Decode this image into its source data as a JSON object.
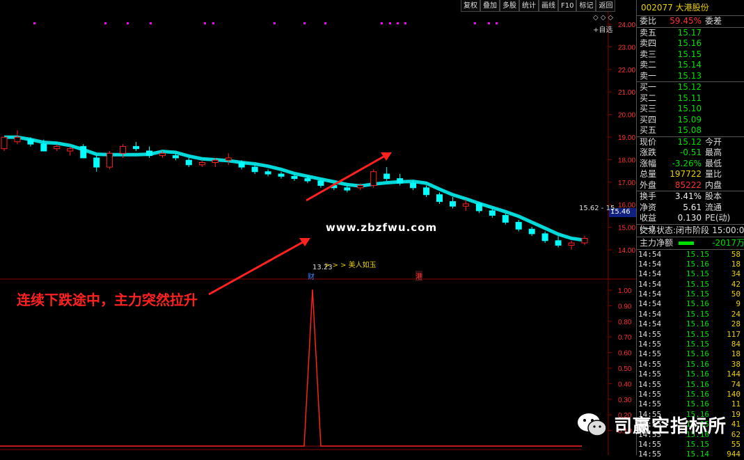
{
  "toolbar": {
    "buttons": [
      "复权",
      "叠加",
      "多股",
      "统计",
      "画线",
      "F10",
      "标记",
      "返回"
    ],
    "auto_select": "+自选",
    "window_controls": [
      "◇",
      "◇",
      "◇"
    ]
  },
  "stock": {
    "code": "002077",
    "name": "大港股份"
  },
  "order_book": {
    "wei_bi_label": "委比",
    "wei_bi_value": "59.45%",
    "wei_cha_label": "委差",
    "asks": [
      {
        "label": "卖五",
        "price": "15.17"
      },
      {
        "label": "卖四",
        "price": "15.16"
      },
      {
        "label": "卖三",
        "price": "15.15"
      },
      {
        "label": "卖二",
        "price": "15.14"
      },
      {
        "label": "卖一",
        "price": "15.13"
      }
    ],
    "bids": [
      {
        "label": "买一",
        "price": "15.12"
      },
      {
        "label": "买二",
        "price": "15.11"
      },
      {
        "label": "买三",
        "price": "15.10"
      },
      {
        "label": "买四",
        "price": "15.09"
      },
      {
        "label": "买五",
        "price": "15.08"
      }
    ]
  },
  "quote": [
    {
      "label": "现价",
      "value": "15.12",
      "label2": "今开",
      "color": "green"
    },
    {
      "label": "涨跌",
      "value": "-0.51",
      "label2": "最高",
      "color": "green"
    },
    {
      "label": "涨幅",
      "value": "-3.26%",
      "label2": "最低",
      "color": "green"
    },
    {
      "label": "总量",
      "value": "197722",
      "label2": "量比",
      "color": "yellow"
    },
    {
      "label": "外盘",
      "value": "85222",
      "label2": "内盘",
      "color": "red"
    }
  ],
  "stats": [
    {
      "label": "换手",
      "value": "3.41%",
      "label2": "股本",
      "color": "white"
    },
    {
      "label": "净资",
      "value": "5.61",
      "label2": "流通",
      "color": "white"
    },
    {
      "label": "收益(一)",
      "value": "0.130",
      "label2": "PE(动)",
      "color": "white"
    }
  ],
  "trade_status": {
    "label": "交易状态:",
    "value": "闭市阶段",
    "time": "15:00:0"
  },
  "net_flow": {
    "label": "主力净额",
    "value": "-2017万"
  },
  "ticks": [
    {
      "t": "14:54",
      "p": "15.15",
      "v": "58"
    },
    {
      "t": "14:54",
      "p": "15.16",
      "v": "18"
    },
    {
      "t": "14:54",
      "p": "15.15",
      "v": "34"
    },
    {
      "t": "14:54",
      "p": "15.15",
      "v": "42"
    },
    {
      "t": "14:54",
      "p": "15.15",
      "v": "50"
    },
    {
      "t": "14:54",
      "p": "15.16",
      "v": "9"
    },
    {
      "t": "14:54",
      "p": "15.15",
      "v": "24"
    },
    {
      "t": "14:54",
      "p": "15.16",
      "v": "28"
    },
    {
      "t": "14:55",
      "p": "15.15",
      "v": "117"
    },
    {
      "t": "14:55",
      "p": "15.15",
      "v": "84"
    },
    {
      "t": "14:55",
      "p": "15.16",
      "v": "18"
    },
    {
      "t": "14:55",
      "p": "15.16",
      "v": "38"
    },
    {
      "t": "14:55",
      "p": "15.16",
      "v": "144"
    },
    {
      "t": "14:55",
      "p": "15.16",
      "v": "74"
    },
    {
      "t": "14:55",
      "p": "15.16",
      "v": "140"
    },
    {
      "t": "14:55",
      "p": "15.16",
      "v": "11"
    },
    {
      "t": "14:55",
      "p": "15.16",
      "v": "19"
    },
    {
      "t": "14:55",
      "p": "15.15",
      "v": "41"
    },
    {
      "t": "14:55",
      "p": "15.16",
      "v": "62"
    },
    {
      "t": "14:55",
      "p": "15.15",
      "v": "55"
    },
    {
      "t": "14:55",
      "p": "15.14",
      "v": "944"
    }
  ],
  "chart_labels": {
    "annotation": "连续下跌途中，主力突然拉升",
    "site": "www.zbzfwu.com",
    "low_marker": "13.23",
    "arrows_text": "> > > 美人如玉",
    "cai": "财",
    "gang": "港",
    "high_marker": "15.62 - 15",
    "current_price_box": "15.46"
  },
  "watermark": "司赢空指标所",
  "colors": {
    "up": "#ff2020",
    "down": "#00ffff",
    "line": "#2060ff",
    "grid": "#8b0000"
  },
  "chart_data": [
    {
      "type": "candlestick",
      "y_ticks": [
        "24.00",
        "23.00",
        "22.00",
        "21.00",
        "20.00",
        "19.00",
        "18.00",
        "17.00",
        "16.00",
        "15.00",
        "14.00"
      ],
      "ylim": [
        13.0,
        24.3
      ]
    },
    {
      "type": "line",
      "y_ticks": [
        "1.00",
        "0.90",
        "0.80",
        "0.70",
        "0.60",
        "0.50",
        "0.40",
        "0.30",
        "0.20",
        "0.10"
      ],
      "ylim": [
        0,
        1.0
      ],
      "series": [
        {
          "values_note_free": true,
          "spike_value": 1.0
        }
      ]
    }
  ]
}
